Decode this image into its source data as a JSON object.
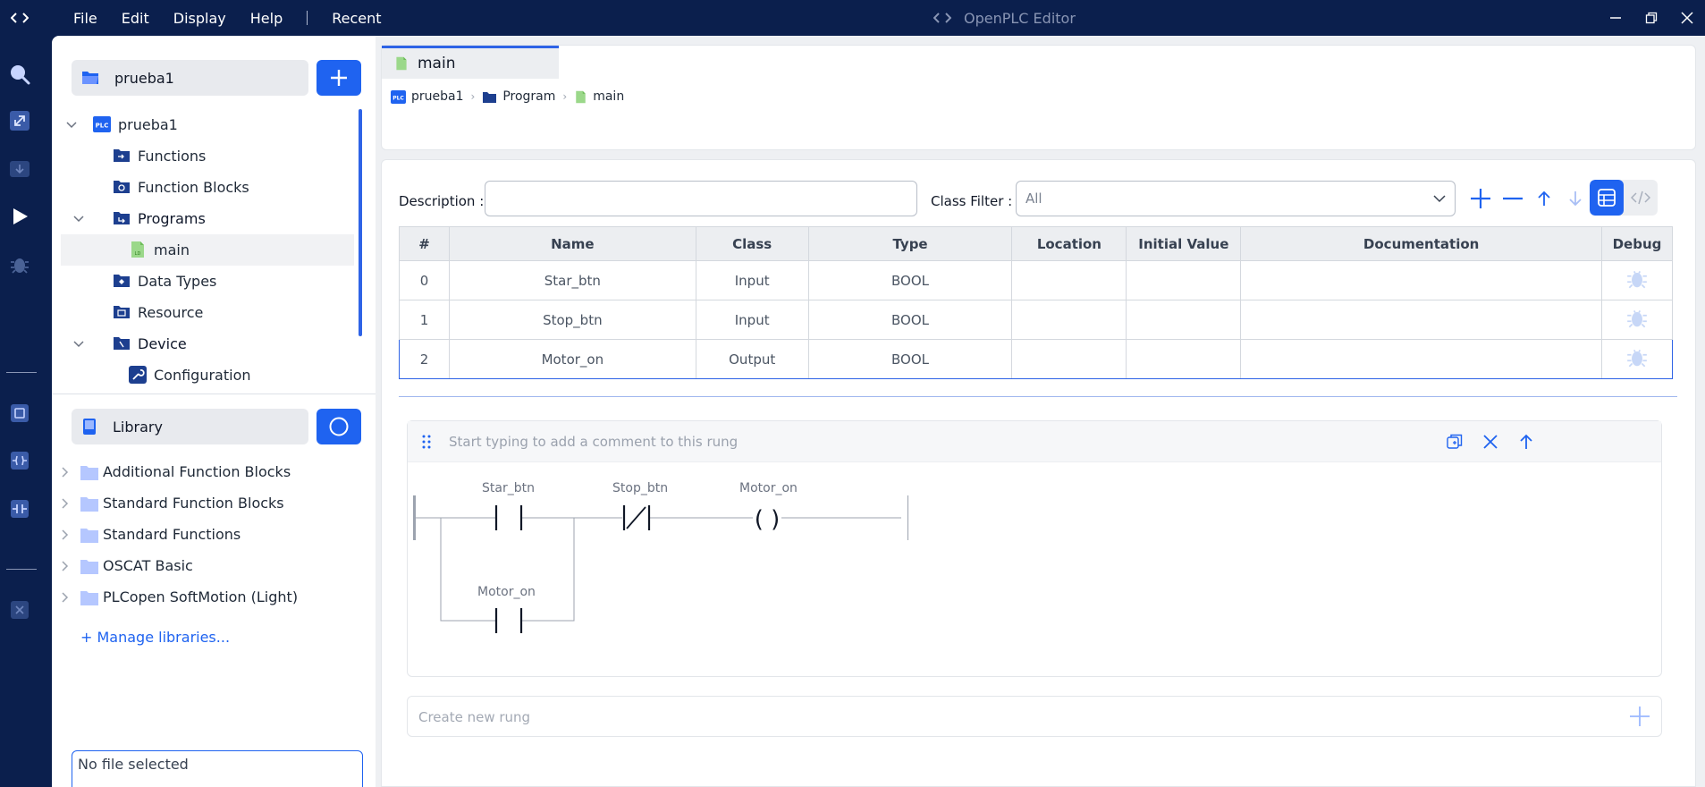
{
  "app": {
    "title": "OpenPLC Editor"
  },
  "menu": [
    "File",
    "Edit",
    "Display",
    "Help",
    "Recent"
  ],
  "project": {
    "name": "prueba1"
  },
  "tree": {
    "root": "prueba1",
    "root_badge": "PLC",
    "functions": "Functions",
    "function_blocks": "Function Blocks",
    "programs": "Programs",
    "main": "main",
    "data_types": "Data Types",
    "resource": "Resource",
    "device": "Device",
    "configuration": "Configuration"
  },
  "library": {
    "title": "Library",
    "items": [
      "Additional Function Blocks",
      "Standard Function Blocks",
      "Standard Functions",
      "OSCAT Basic",
      "PLCopen SoftMotion (Light)"
    ],
    "manage": "+ Manage libraries..."
  },
  "file_status": "No file selected",
  "tab": {
    "label": "main"
  },
  "breadcrumb": {
    "project": "prueba1",
    "project_badge": "PLC",
    "program": "Program",
    "pou": "main"
  },
  "toolbar": {
    "description_label": "Description :",
    "description_value": "",
    "class_filter_label": "Class Filter :",
    "class_filter_value": "All"
  },
  "variables": {
    "columns": [
      "#",
      "Name",
      "Class",
      "Type",
      "Location",
      "Initial Value",
      "Documentation",
      "Debug"
    ],
    "rows": [
      {
        "index": "0",
        "name": "Star_btn",
        "class": "Input",
        "type": "BOOL",
        "location": "",
        "initial": "",
        "doc": ""
      },
      {
        "index": "1",
        "name": "Stop_btn",
        "class": "Input",
        "type": "BOOL",
        "location": "",
        "initial": "",
        "doc": ""
      },
      {
        "index": "2",
        "name": "Motor_on",
        "class": "Output",
        "type": "BOOL",
        "location": "",
        "initial": "",
        "doc": ""
      }
    ]
  },
  "rung": {
    "comment_placeholder": "Start typing to add a comment to this rung",
    "contacts": [
      "Star_btn",
      "Stop_btn",
      "Motor_on"
    ],
    "coil": "Motor_on",
    "coil_symbol": "( )"
  },
  "new_rung": "Create new rung",
  "colors": {
    "accent": "#1f63f0",
    "navy": "#0b1f4d",
    "icon_dark": "#1d3f8f"
  }
}
